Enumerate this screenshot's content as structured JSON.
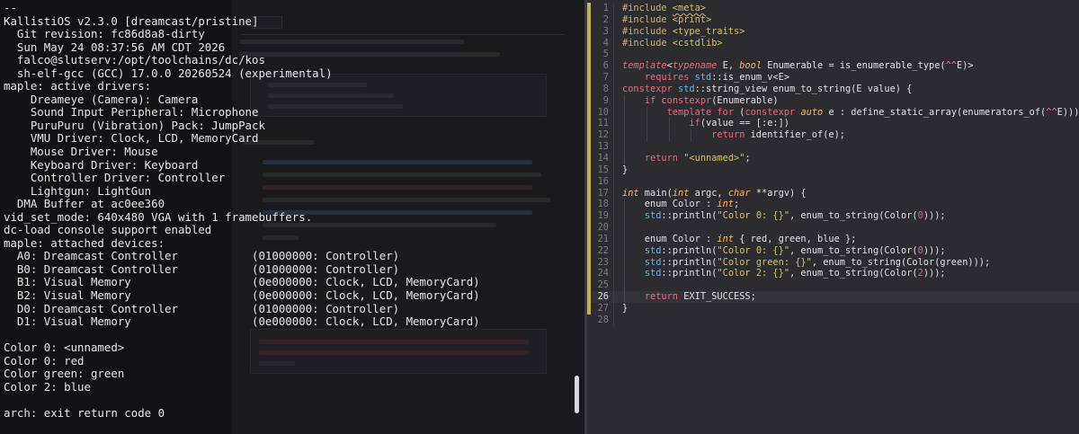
{
  "terminal": {
    "lines": [
      "--",
      "KallistiOS v2.3.0 [dreamcast/pristine]",
      "  Git revision: fc86d8a8-dirty",
      "  Sun May 24 08:37:56 AM CDT 2026",
      "  falco@slutserv:/opt/toolchains/dc/kos",
      "  sh-elf-gcc (GCC) 17.0.0 20260524 (experimental)",
      "maple: active drivers:",
      "    Dreameye (Camera): Camera",
      "    Sound Input Peripheral: Microphone",
      "    PuruPuru (Vibration) Pack: JumpPack",
      "    VMU Driver: Clock, LCD, MemoryCard",
      "    Mouse Driver: Mouse",
      "    Keyboard Driver: Keyboard",
      "    Controller Driver: Controller",
      "    Lightgun: LightGun",
      "  DMA Buffer at ac0ee360",
      "vid_set_mode: 640x480 VGA with 1 framebuffers.",
      "dc-load console support enabled",
      "maple: attached devices:",
      "  A0: Dreamcast Controller           (01000000: Controller)",
      "  B0: Dreamcast Controller           (01000000: Controller)",
      "  B1: Visual Memory                  (0e000000: Clock, LCD, MemoryCard)",
      "  B2: Visual Memory                  (0e000000: Clock, LCD, MemoryCard)",
      "  D0: Dreamcast Controller           (01000000: Controller)",
      "  D1: Visual Memory                  (0e000000: Clock, LCD, MemoryCard)",
      "",
      "Color 0: <unnamed>",
      "Color 0: red",
      "Color green: green",
      "Color 2: blue",
      "",
      "arch: exit return code 0"
    ]
  },
  "editor": {
    "current_line": 26,
    "modified_lines": [
      1,
      2,
      3,
      4,
      5,
      6,
      7,
      8,
      9,
      10,
      11,
      12,
      13,
      14,
      15,
      16,
      17,
      18,
      19,
      20,
      21,
      22,
      23,
      24,
      25,
      26,
      27
    ],
    "lines": [
      {
        "n": "1",
        "indent": 0,
        "guides": [],
        "t": [
          [
            "tk-pre",
            "#include "
          ],
          [
            "tk-str squiggle",
            "<meta>"
          ]
        ]
      },
      {
        "n": "2",
        "indent": 0,
        "guides": [],
        "t": [
          [
            "tk-pre",
            "#include "
          ],
          [
            "tk-str",
            "<print>"
          ]
        ]
      },
      {
        "n": "3",
        "indent": 0,
        "guides": [],
        "t": [
          [
            "tk-pre",
            "#include "
          ],
          [
            "tk-str",
            "<type_traits>"
          ]
        ]
      },
      {
        "n": "4",
        "indent": 0,
        "guides": [],
        "t": [
          [
            "tk-pre",
            "#include "
          ],
          [
            "tk-str",
            "<cstdlib>"
          ]
        ]
      },
      {
        "n": "5",
        "indent": 0,
        "guides": [],
        "t": []
      },
      {
        "n": "6",
        "indent": 0,
        "guides": [],
        "t": [
          [
            "tk-kw",
            "template"
          ],
          [
            "tk-plain",
            "<"
          ],
          [
            "tk-kw",
            "typename"
          ],
          [
            "tk-plain",
            " E, "
          ],
          [
            "tk-type",
            "bool"
          ],
          [
            "tk-plain",
            " Enumerable = is_enumerable_type("
          ],
          [
            "tk-pink",
            "^^"
          ],
          [
            "tk-plain",
            "E)>"
          ]
        ]
      },
      {
        "n": "7",
        "indent": 0,
        "guides": [],
        "t": [
          [
            "tk-plain",
            "    "
          ],
          [
            "tk-kw2",
            "requires"
          ],
          [
            "tk-plain",
            " "
          ],
          [
            "tk-ns",
            "std"
          ],
          [
            "tk-plain",
            "::is_enum_v<E>"
          ]
        ]
      },
      {
        "n": "8",
        "indent": 0,
        "guides": [],
        "t": [
          [
            "tk-kw2",
            "constexpr"
          ],
          [
            "tk-plain",
            " "
          ],
          [
            "tk-ns",
            "std"
          ],
          [
            "tk-plain",
            "::string_view enum_to_string(E value) {"
          ]
        ]
      },
      {
        "n": "9",
        "indent": 0,
        "guides": [
          1
        ],
        "t": [
          [
            "tk-plain",
            "    "
          ],
          [
            "tk-kw2",
            "if"
          ],
          [
            "tk-plain",
            " "
          ],
          [
            "tk-kw2",
            "constexpr"
          ],
          [
            "tk-plain",
            "(Enumerable)"
          ]
        ]
      },
      {
        "n": "10",
        "indent": 0,
        "guides": [
          1,
          2
        ],
        "t": [
          [
            "tk-plain",
            "        "
          ],
          [
            "tk-kw2",
            "template"
          ],
          [
            "tk-plain",
            " "
          ],
          [
            "tk-kw2",
            "for"
          ],
          [
            "tk-plain",
            " ("
          ],
          [
            "tk-kw2",
            "constexpr"
          ],
          [
            "tk-plain",
            " "
          ],
          [
            "tk-type",
            "auto"
          ],
          [
            "tk-plain",
            " e : define_static_array(enumerators_of("
          ],
          [
            "tk-pink",
            "^^"
          ],
          [
            "tk-plain",
            "E)))"
          ]
        ]
      },
      {
        "n": "11",
        "indent": 0,
        "guides": [
          1,
          2,
          3
        ],
        "t": [
          [
            "tk-plain",
            "            "
          ],
          [
            "tk-kw2",
            "if"
          ],
          [
            "tk-plain",
            "(value == [:e:])"
          ]
        ]
      },
      {
        "n": "12",
        "indent": 0,
        "guides": [
          1,
          2,
          3,
          4
        ],
        "t": [
          [
            "tk-plain",
            "                "
          ],
          [
            "tk-kw2",
            "return"
          ],
          [
            "tk-plain",
            " identifier_of(e);"
          ]
        ]
      },
      {
        "n": "13",
        "indent": 0,
        "guides": [
          1
        ],
        "t": []
      },
      {
        "n": "14",
        "indent": 0,
        "guides": [
          1
        ],
        "t": [
          [
            "tk-plain",
            "    "
          ],
          [
            "tk-kw2",
            "return"
          ],
          [
            "tk-plain",
            " "
          ],
          [
            "tk-str",
            "\"<unnamed>\""
          ],
          [
            "tk-plain",
            ";"
          ]
        ]
      },
      {
        "n": "15",
        "indent": 0,
        "guides": [],
        "t": [
          [
            "tk-plain",
            "}"
          ]
        ]
      },
      {
        "n": "16",
        "indent": 0,
        "guides": [],
        "t": []
      },
      {
        "n": "17",
        "indent": 0,
        "guides": [],
        "t": [
          [
            "tk-type",
            "int"
          ],
          [
            "tk-plain",
            " main("
          ],
          [
            "tk-type",
            "int"
          ],
          [
            "tk-plain",
            " argc, "
          ],
          [
            "tk-type",
            "char"
          ],
          [
            "tk-plain",
            " **argv) {"
          ]
        ]
      },
      {
        "n": "18",
        "indent": 0,
        "guides": [
          1
        ],
        "t": [
          [
            "tk-plain",
            "    enum Color : "
          ],
          [
            "tk-type",
            "int"
          ],
          [
            "tk-plain",
            ";"
          ]
        ]
      },
      {
        "n": "19",
        "indent": 0,
        "guides": [
          1
        ],
        "t": [
          [
            "tk-plain",
            "    "
          ],
          [
            "tk-ns",
            "std"
          ],
          [
            "tk-plain",
            "::println("
          ],
          [
            "tk-str",
            "\"Color 0: {}\""
          ],
          [
            "tk-plain",
            ", enum_to_string(Color("
          ],
          [
            "tk-num",
            "0"
          ],
          [
            "tk-plain",
            ")));"
          ]
        ]
      },
      {
        "n": "20",
        "indent": 0,
        "guides": [
          1
        ],
        "t": []
      },
      {
        "n": "21",
        "indent": 0,
        "guides": [
          1
        ],
        "t": [
          [
            "tk-plain",
            "    enum Color : "
          ],
          [
            "tk-type",
            "int"
          ],
          [
            "tk-plain",
            " { red, green, blue };"
          ]
        ]
      },
      {
        "n": "22",
        "indent": 0,
        "guides": [
          1
        ],
        "t": [
          [
            "tk-plain",
            "    "
          ],
          [
            "tk-ns",
            "std"
          ],
          [
            "tk-plain",
            "::println("
          ],
          [
            "tk-str",
            "\"Color 0: {}\""
          ],
          [
            "tk-plain",
            ", enum_to_string(Color("
          ],
          [
            "tk-num",
            "0"
          ],
          [
            "tk-plain",
            ")));"
          ]
        ]
      },
      {
        "n": "23",
        "indent": 0,
        "guides": [
          1
        ],
        "t": [
          [
            "tk-plain",
            "    "
          ],
          [
            "tk-ns",
            "std"
          ],
          [
            "tk-plain",
            "::println("
          ],
          [
            "tk-str",
            "\"Color green: {}\""
          ],
          [
            "tk-plain",
            ", enum_to_string(Color(green)));"
          ]
        ]
      },
      {
        "n": "24",
        "indent": 0,
        "guides": [
          1
        ],
        "t": [
          [
            "tk-plain",
            "    "
          ],
          [
            "tk-ns",
            "std"
          ],
          [
            "tk-plain",
            "::println("
          ],
          [
            "tk-str",
            "\"Color 2: {}\""
          ],
          [
            "tk-plain",
            ", enum_to_string(Color("
          ],
          [
            "tk-num",
            "2"
          ],
          [
            "tk-plain",
            ")));"
          ]
        ]
      },
      {
        "n": "25",
        "indent": 0,
        "guides": [
          1
        ],
        "t": []
      },
      {
        "n": "26",
        "indent": 0,
        "guides": [
          1
        ],
        "t": [
          [
            "tk-plain",
            "    "
          ],
          [
            "tk-kw2",
            "return"
          ],
          [
            "tk-plain",
            " EXIT_SUCCESS;"
          ]
        ]
      },
      {
        "n": "27",
        "indent": 0,
        "guides": [],
        "t": [
          [
            "tk-plain",
            "}"
          ]
        ]
      },
      {
        "n": "28",
        "indent": 0,
        "guides": [],
        "t": []
      }
    ]
  }
}
